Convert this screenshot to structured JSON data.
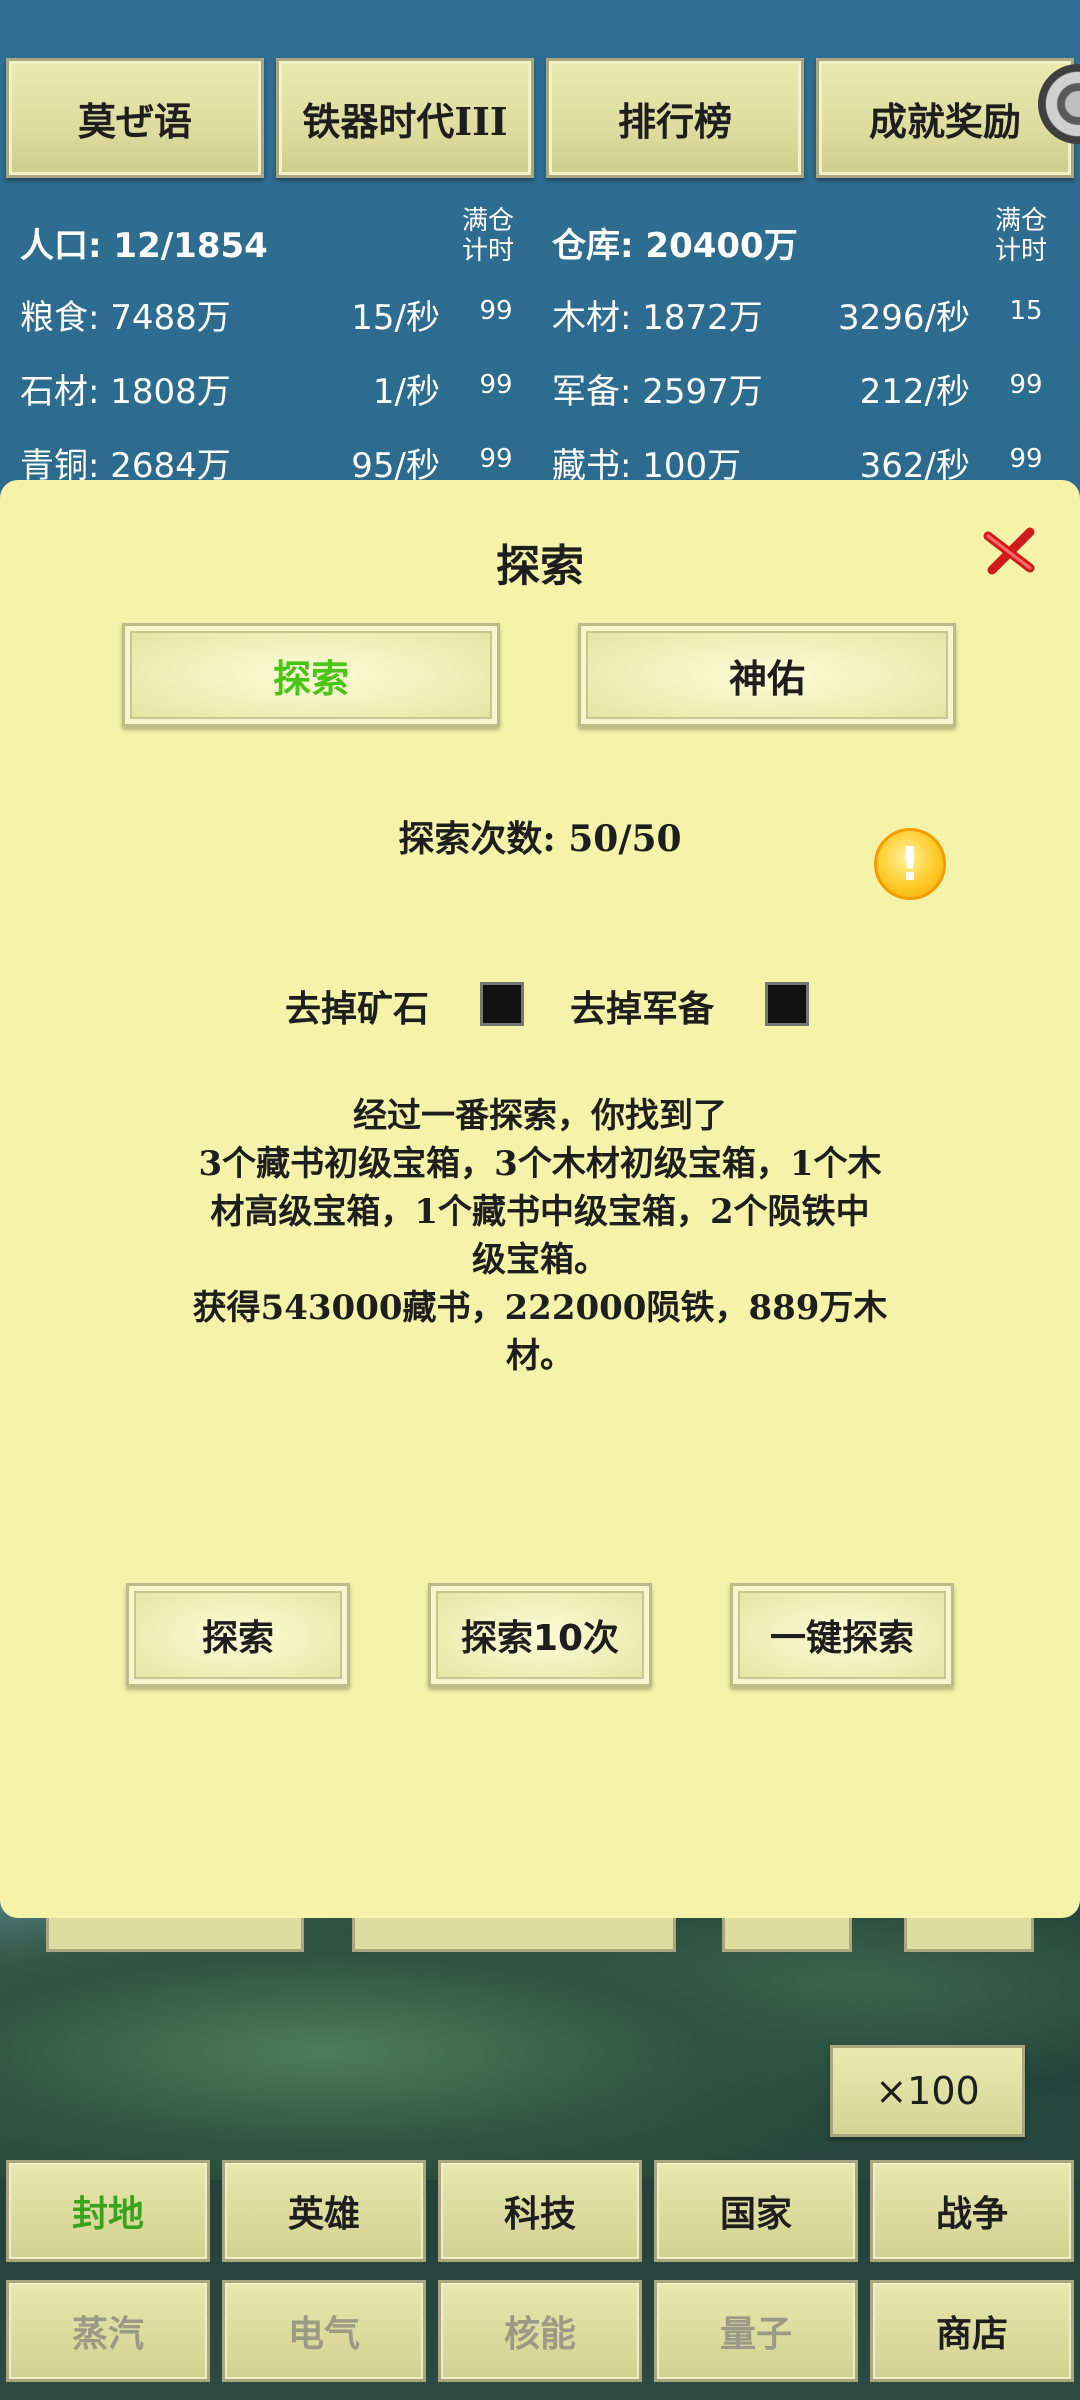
{
  "top_buttons": [
    "莫ぜ语",
    "铁器时代III",
    "排行榜",
    "成就奖励"
  ],
  "resources": {
    "population": "人口: 12/1854",
    "full_hint_left": [
      "满仓",
      "计时"
    ],
    "warehouse": "仓库: 20400万",
    "full_hint_right": [
      "满仓",
      "计时"
    ],
    "rows": [
      {
        "left_name": "粮食: 7488万",
        "left_rate": "15/秒",
        "left_timer": "99",
        "right_name": "木材: 1872万",
        "right_rate": "3296/秒",
        "right_timer": "15"
      },
      {
        "left_name": "石材: 1808万",
        "left_rate": "1/秒",
        "left_timer": "99",
        "right_name": "军备: 2597万",
        "right_rate": "212/秒",
        "right_timer": "99"
      },
      {
        "left_name": "青铜: 2684万",
        "left_rate": "95/秒",
        "left_timer": "99",
        "right_name": "藏书: 100万",
        "right_rate": "362/秒",
        "right_timer": "99"
      }
    ]
  },
  "modal": {
    "title": "探索",
    "tabs": [
      "探索",
      "神佑"
    ],
    "count_label": "探索次数: 50/50",
    "alert_glyph": "!",
    "options": [
      "去掉矿石",
      "去掉军备"
    ],
    "result_lines": [
      "经过一番探索，你找到了",
      "3个藏书初级宝箱，3个木材初级宝箱，1个木",
      "材高级宝箱，1个藏书中级宝箱，2个陨铁中",
      "级宝箱。",
      "获得543000藏书，222000陨铁，889万木",
      "材。"
    ],
    "actions": [
      "探索",
      "探索10次",
      "一键探索"
    ]
  },
  "multiplier": "×100",
  "bottom_nav": {
    "row1": [
      "封地",
      "英雄",
      "科技",
      "国家",
      "战争"
    ],
    "row2": [
      "蒸汽",
      "电气",
      "核能",
      "量子",
      "商店"
    ]
  },
  "colors": {
    "active_tab": "#4bc419",
    "active_nav": "#3aa31e",
    "modal_bg": "#f4f3a9",
    "header_bg": "#2f6f93"
  },
  "icons": {
    "close": "close-x-icon",
    "alert": "exclamation-circle-icon",
    "settings_edge": "round-toggle-icon"
  }
}
